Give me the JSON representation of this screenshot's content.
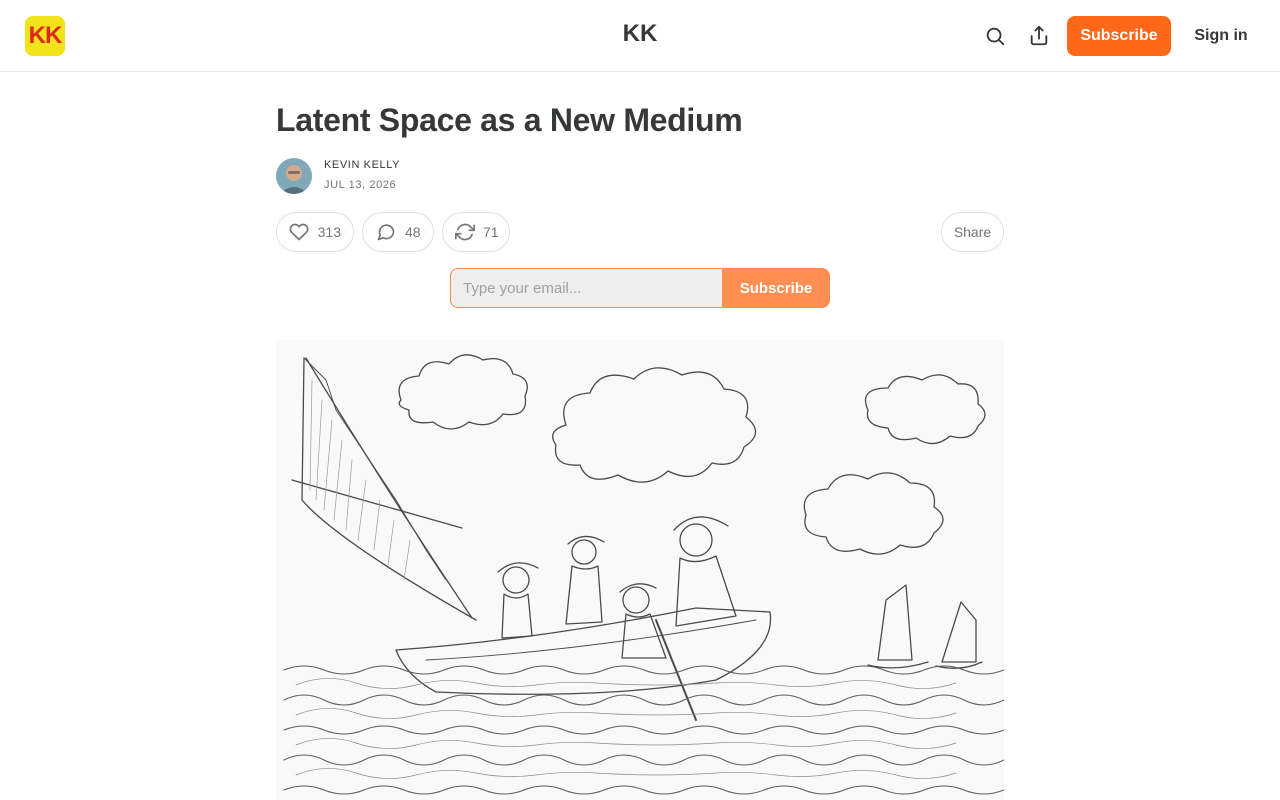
{
  "header": {
    "logo_text": "KK",
    "site_title": "KK",
    "subscribe_label": "Subscribe",
    "signin_label": "Sign in",
    "icons": [
      "search-icon",
      "share-icon"
    ]
  },
  "post": {
    "title": "Latent Space as a New Medium",
    "author": "KEVIN KELLY",
    "date": "JUL 13, 2026",
    "likes": "313",
    "comments": "48",
    "restacks": "71",
    "share_label": "Share"
  },
  "subscribe_form": {
    "placeholder": "Type your email...",
    "button_label": "Subscribe"
  },
  "colors": {
    "brand_orange": "#ff6719",
    "logo_bg": "#f2e21a",
    "logo_text": "#e0271b"
  }
}
